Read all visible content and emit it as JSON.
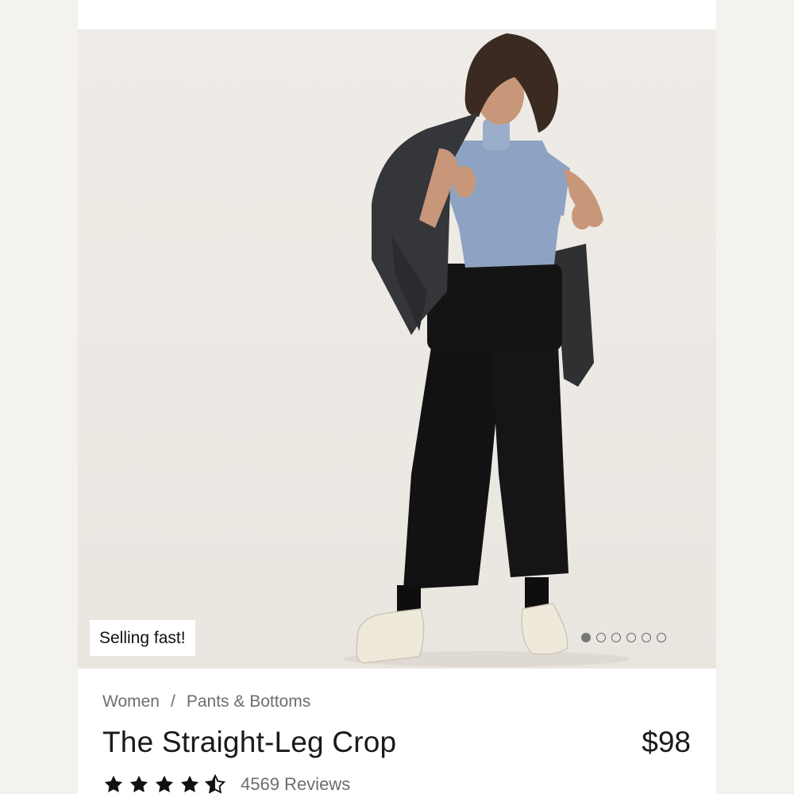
{
  "product": {
    "badge": "Selling fast!",
    "breadcrumb": [
      "Women",
      "/",
      "Pants & Bottoms"
    ],
    "title": "The Straight-Leg Crop",
    "price": "$98",
    "rating": 4.5,
    "rating_max": 5,
    "reviews": "4569 Reviews"
  },
  "carousel": {
    "total": 6,
    "active": 1
  },
  "colors": {
    "text_primary": "#1a1a1a",
    "text_secondary": "#6e6e6e",
    "star": "#111111",
    "dot": "#777777"
  }
}
